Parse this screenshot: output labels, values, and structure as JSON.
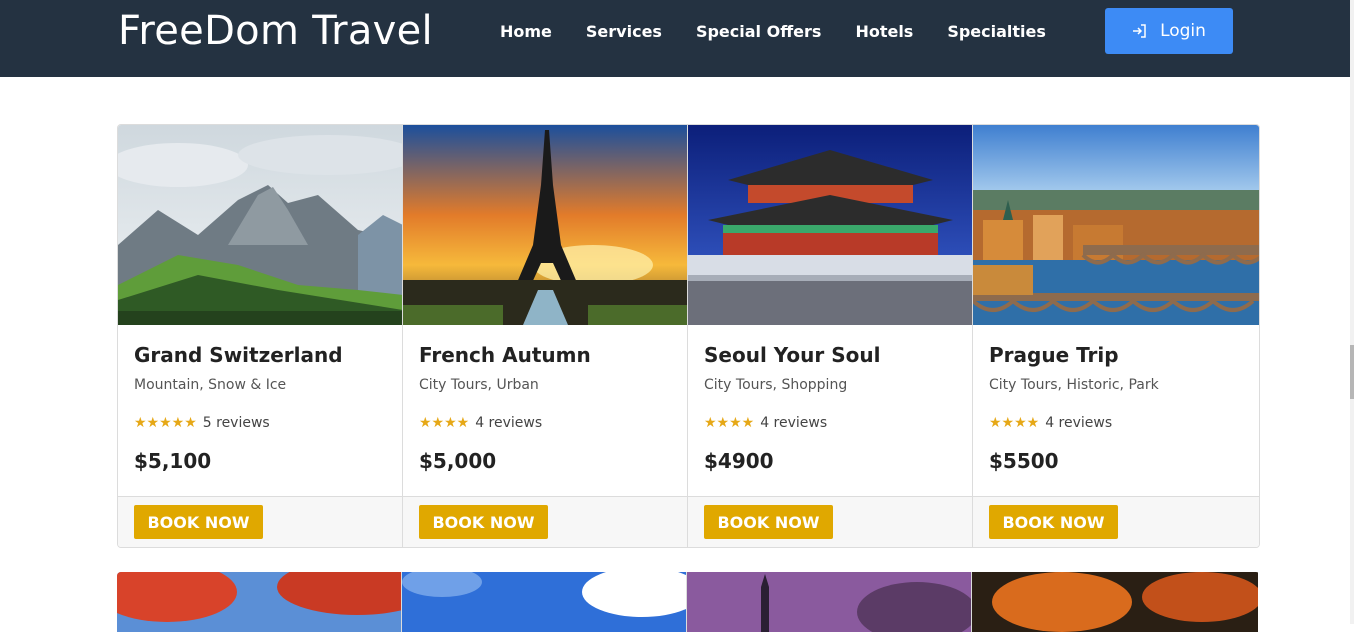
{
  "brand": "FreeDom Travel",
  "nav": [
    "Home",
    "Services",
    "Special Offers",
    "Hotels",
    "Specialties"
  ],
  "login_label": "Login",
  "cards": [
    {
      "title": "Grand Switzerland",
      "tags": "Mountain, Snow & Ice",
      "stars": "★★★★★",
      "reviews": "5 reviews",
      "price": "$5,100",
      "cta": "BOOK NOW",
      "image": "swiss-alps-mountain"
    },
    {
      "title": "French Autumn",
      "tags": "City Tours, Urban",
      "stars": "★★★★",
      "reviews": "4 reviews",
      "price": "$5,000",
      "cta": "BOOK NOW",
      "image": "eiffel-tower-sunset"
    },
    {
      "title": "Seoul Your Soul",
      "tags": "City Tours, Shopping",
      "stars": "★★★★",
      "reviews": "4 reviews",
      "price": "$4900",
      "cta": "BOOK NOW",
      "image": "seoul-palace-night"
    },
    {
      "title": "Prague Trip",
      "tags": "City Tours, Historic, Park",
      "stars": "★★★★",
      "reviews": "4 reviews",
      "price": "$5500",
      "cta": "BOOK NOW",
      "image": "prague-bridges-river"
    }
  ],
  "colors": {
    "navbar": "#243241",
    "login": "#3d8bf5",
    "book": "#e0a800",
    "stars": "#e6a817"
  }
}
